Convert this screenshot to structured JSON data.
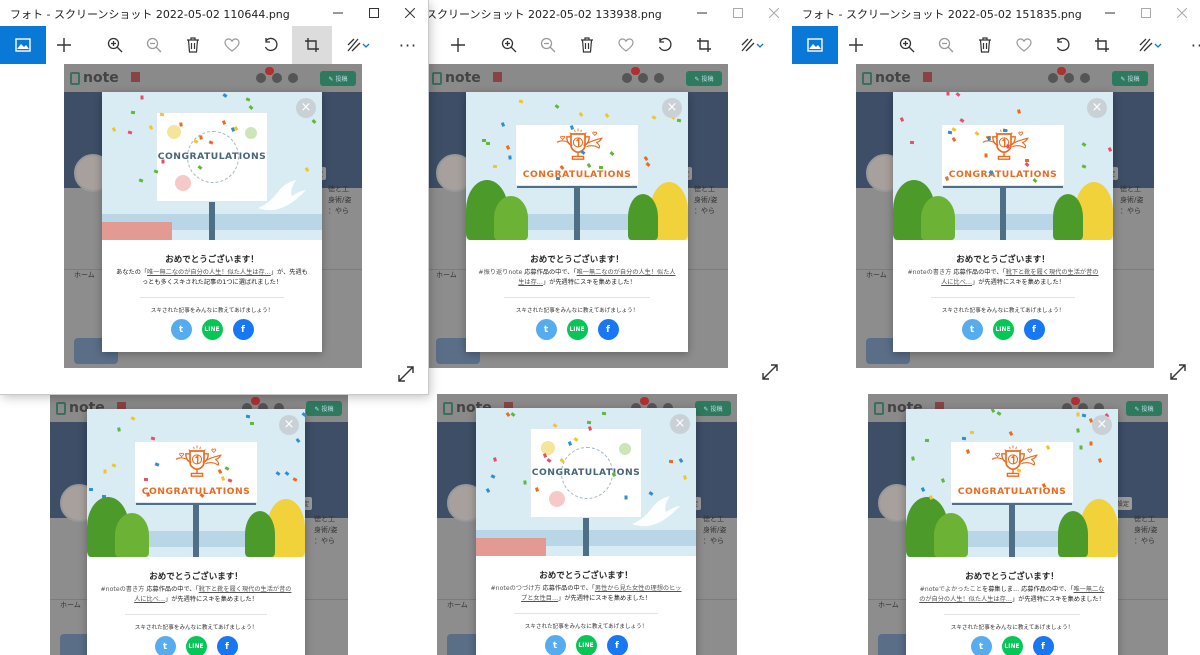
{
  "windows": [
    {
      "title": "フォト - スクリーンショット 2022-05-02 110644.png",
      "hasTitlebar": true
    },
    {
      "title": "スクリーンショット 2022-05-02 133938.png",
      "hasTitlebar": true
    },
    {
      "title": "フォト - スクリーンショット 2022-05-02 151835.png",
      "hasTitlebar": true
    },
    {
      "title": "",
      "hasTitlebar": false
    },
    {
      "title": "",
      "hasTitlebar": false
    },
    {
      "title": "",
      "hasTitlebar": false
    }
  ],
  "toolbar": {
    "more_label": "···"
  },
  "note_page": {
    "logo_text": "note",
    "post_button": "✎ 投稿",
    "settings_label": "設定",
    "home_tab": "ホーム",
    "side_text": "徳と工 身術/姿 ：やら",
    "bell_count": "18"
  },
  "modals": [
    {
      "variant": "dove",
      "billboard_text": "CONGRATULATIONS",
      "heading": "おめでとうございます！",
      "pre": "あなたの「",
      "link": "唯一無二なのが自分の人生！似た人生は存…",
      "post": "」が、先週もっとも多くスキされた記事の1つに選ばれました！",
      "tag": "",
      "share_prompt": "スキされた記事をみんなに教えてあげましょう！"
    },
    {
      "variant": "trophy",
      "billboard_text": "CONGRATULATIONS",
      "heading": "おめでとうございます！",
      "tag": "#振り返りnote",
      "pre": " 応募作品の中で、「",
      "link": "唯一無二なのが自分の人生！似た人生は存…",
      "post": "」が先週特にスキを集めました！",
      "share_prompt": "スキされた記事をみんなに教えてあげましょう！"
    },
    {
      "variant": "trophy",
      "billboard_text": "CONGRATULATIONS",
      "heading": "おめでとうございます！",
      "tag": "#noteの書き方",
      "pre": " 応募作品の中で、「",
      "link": "靴下と靴を履く現代の生活が昔の人に比べ…",
      "post": "」が先週特にスキを集めました！",
      "share_prompt": "スキされた記事をみんなに教えてあげましょう！"
    },
    {
      "variant": "trophy",
      "billboard_text": "CONGRATULATIONS",
      "heading": "おめでとうございます！",
      "tag": "#noteの書き方",
      "pre": " 応募作品の中で、「",
      "link": "靴下と靴を履く現代の生活が昔の人に比べ…",
      "post": "」が先週特にスキを集めました！",
      "share_prompt": "スキされた記事をみんなに教えてあげましょう！"
    },
    {
      "variant": "dove",
      "billboard_text": "CONGRATULATIONS",
      "heading": "おめでとうございます！",
      "tag": "#noteのつづけ方",
      "pre": " 応募作品の中で、「",
      "link": "男性から見た女性の理想のヒップと女性目…",
      "post": "」が先週特にスキを集めました！",
      "share_prompt": "スキされた記事をみんなに教えてあげましょう！"
    },
    {
      "variant": "trophy",
      "billboard_text": "CONGRATULATIONS",
      "heading": "おめでとうございます！",
      "tag": "#noteでよかったこと",
      "pre": "を募集しま… 応募作品の中で、「",
      "link": "唯一無二なのが自分の人生！似た人生は存…",
      "post": "」が先週特にスキを集めました！",
      "share_prompt": "スキされた記事をみんなに教えてあげましょう！"
    }
  ],
  "share_buttons": {
    "twitter": "t",
    "line": "LINE",
    "facebook": "f"
  },
  "colors": {
    "accent": "#0a78d7",
    "note_green": "#2d7a5f",
    "congrats_orange": "#ee6a1f",
    "twitter": "#55acee",
    "line": "#06c755",
    "facebook": "#1877f2"
  }
}
